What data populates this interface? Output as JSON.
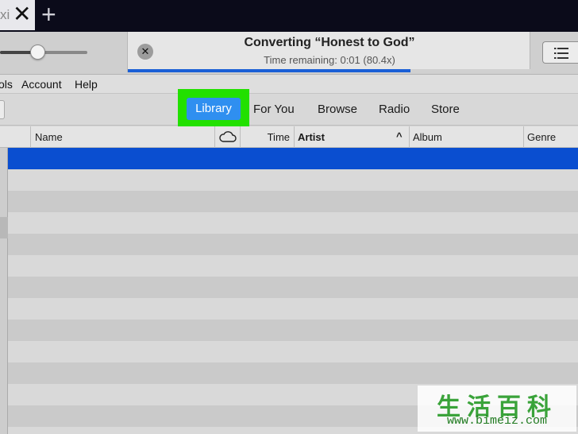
{
  "browser": {
    "tab_text": "xi",
    "close_glyph": "✕",
    "new_tab_glyph": "+"
  },
  "player": {
    "volume_fraction": 0.43,
    "status_title": "Converting “Honest to God”",
    "status_subtitle": "Time remaining: 0:01 (80.4x)",
    "progress_fraction": 0.7,
    "cancel_glyph": "✕"
  },
  "menu": {
    "items": [
      "ols",
      "Account",
      "Help"
    ]
  },
  "nav": {
    "items": [
      "Library",
      "For You",
      "Browse",
      "Radio",
      "Store"
    ],
    "selected": "Library"
  },
  "columns": {
    "name": "Name",
    "time": "Time",
    "artist": "Artist",
    "album": "Album",
    "genre": "Genre",
    "sort_glyph": "^"
  },
  "watermark": {
    "chinese": "生活百科",
    "url": "www.bimeiz.com"
  },
  "colors": {
    "selected_row": "#0a4ed0",
    "library_button": "#2f8ff0",
    "highlight_box": "#22e000",
    "progress": "#1a5fd6"
  }
}
